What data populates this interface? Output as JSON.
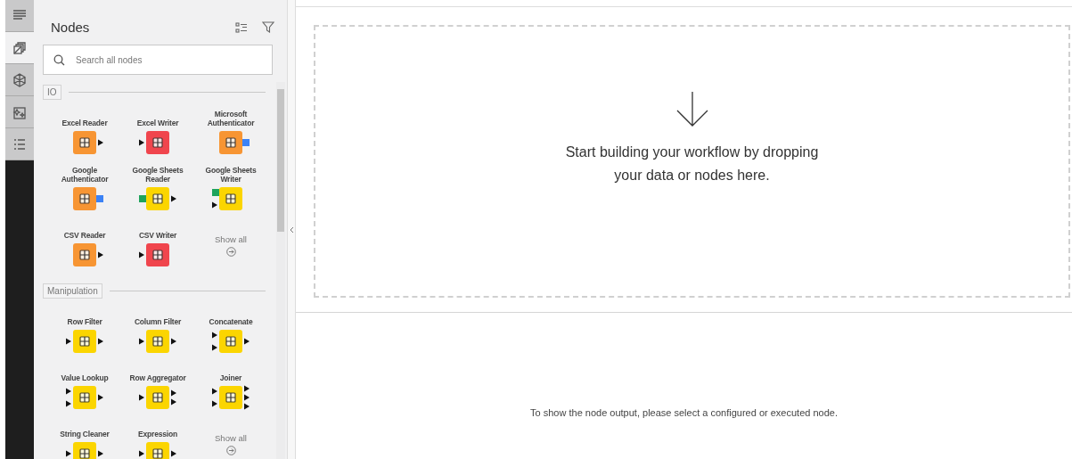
{
  "rail": {
    "tabs": [
      {
        "kind": "description",
        "selected": false
      },
      {
        "kind": "nodes",
        "selected": true
      },
      {
        "kind": "components",
        "selected": false
      },
      {
        "kind": "ai",
        "selected": false
      },
      {
        "kind": "monitor",
        "selected": false
      }
    ]
  },
  "panel": {
    "title": "Nodes",
    "search": {
      "placeholder": "Search all nodes"
    },
    "sections": [
      {
        "title": "IO",
        "nodes": [
          {
            "name": "Excel Reader",
            "kind": "source",
            "out": [
              {
                "kind": "data"
              }
            ]
          },
          {
            "name": "Excel Writer",
            "kind": "sink",
            "in": [
              {
                "kind": "data"
              }
            ]
          },
          {
            "name": "Microsoft Authenticator",
            "kind": "source",
            "out": [
              {
                "kind": "auth"
              }
            ]
          },
          {
            "name": "Google Authenticator",
            "kind": "source",
            "out": [
              {
                "kind": "auth"
              }
            ]
          },
          {
            "name": "Google Sheets Reader",
            "kind": "manipulator",
            "in": [
              {
                "kind": "sheet"
              }
            ],
            "out": [
              {
                "kind": "data"
              }
            ]
          },
          {
            "name": "Google Sheets Writer",
            "kind": "manipulator",
            "in": [
              {
                "kind": "sheet"
              },
              {
                "kind": "data"
              }
            ]
          },
          {
            "name": "CSV Reader",
            "kind": "source",
            "out": [
              {
                "kind": "data"
              }
            ]
          },
          {
            "name": "CSV Writer",
            "kind": "sink",
            "in": [
              {
                "kind": "data"
              }
            ]
          }
        ],
        "show_all": "Show all"
      },
      {
        "title": "Manipulation",
        "nodes": [
          {
            "name": "Row Filter",
            "kind": "manipulator",
            "in": [
              {
                "kind": "data"
              }
            ],
            "out": [
              {
                "kind": "data"
              }
            ]
          },
          {
            "name": "Column Filter",
            "kind": "manipulator",
            "in": [
              {
                "kind": "data"
              }
            ],
            "out": [
              {
                "kind": "data"
              }
            ]
          },
          {
            "name": "Concatenate",
            "kind": "manipulator",
            "in": [
              {
                "kind": "data"
              },
              {
                "kind": "data"
              }
            ],
            "out": [
              {
                "kind": "data"
              }
            ]
          },
          {
            "name": "Value Lookup",
            "kind": "manipulator",
            "in": [
              {
                "kind": "data"
              },
              {
                "kind": "data"
              }
            ],
            "out": [
              {
                "kind": "data"
              }
            ]
          },
          {
            "name": "Row Aggregator",
            "kind": "manipulator",
            "in": [
              {
                "kind": "data"
              }
            ],
            "out": [
              {
                "kind": "data"
              },
              {
                "kind": "data"
              }
            ]
          },
          {
            "name": "Joiner",
            "kind": "manipulator",
            "in": [
              {
                "kind": "data"
              },
              {
                "kind": "data"
              }
            ],
            "out": [
              {
                "kind": "data"
              },
              {
                "kind": "data"
              },
              {
                "kind": "data"
              }
            ]
          },
          {
            "name": "String Cleaner",
            "kind": "manipulator",
            "in": [
              {
                "kind": "data"
              }
            ],
            "out": [
              {
                "kind": "data"
              }
            ]
          },
          {
            "name": "Expression",
            "kind": "manipulator",
            "in": [
              {
                "kind": "data"
              }
            ],
            "out": [
              {
                "kind": "data"
              }
            ]
          }
        ],
        "show_all": "Show all"
      }
    ]
  },
  "canvas": {
    "hint": "Start building your workflow by dropping your data or nodes here."
  },
  "output": {
    "message": "To show the node output, please select a configured or executed node."
  }
}
